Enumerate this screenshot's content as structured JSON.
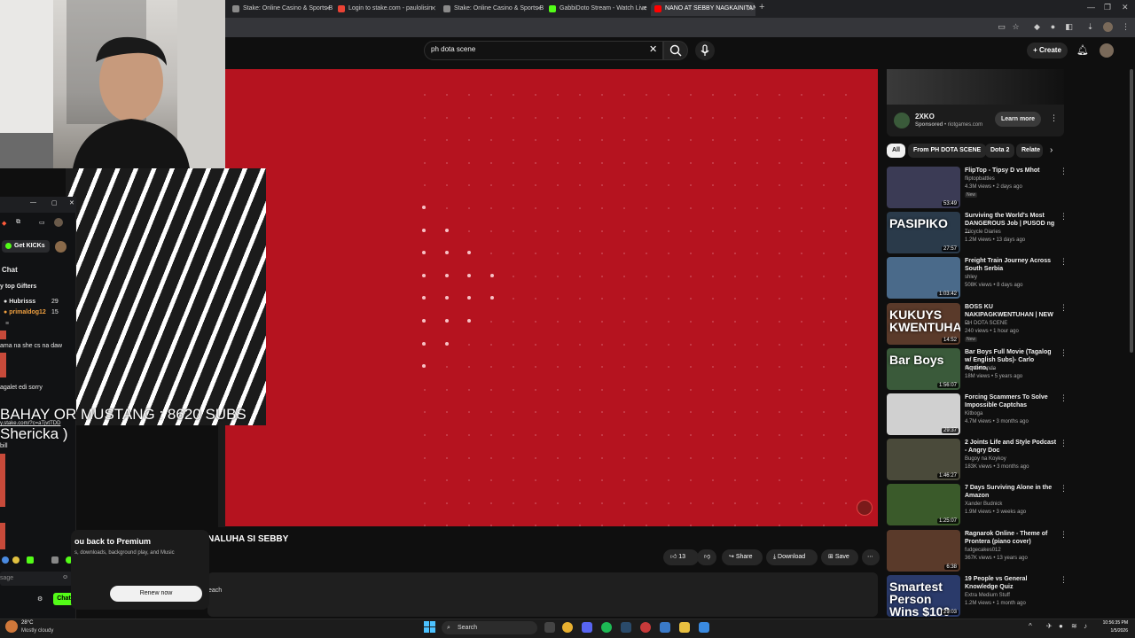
{
  "browser": {
    "tabs": [
      {
        "label": "Stake: Online Casino & Sports B",
        "favicon_color": "#8a8a8a"
      },
      {
        "label": "Login to stake.com - paulolisin",
        "favicon_color": "#ea4335"
      },
      {
        "label": "Stake: Online Casino & Sports B",
        "favicon_color": "#8a8a8a"
      },
      {
        "label": "GabbiDoto Stream - Watch Live",
        "favicon_color": "#53fc18"
      },
      {
        "label": "NANO AT SEBBY NAGKAINITAN",
        "favicon_color": "#ff0000"
      }
    ],
    "new_tab": "+",
    "window_controls": [
      "—",
      "❐",
      "✕"
    ]
  },
  "youtube": {
    "search_value": "ph dota scene",
    "create_label": "Create",
    "video_title": "NALUHA SI SEBBY",
    "actions": {
      "likes": "13",
      "share": "Share",
      "download": "Download",
      "save": "Save"
    },
    "description_snippet": "each",
    "ad": {
      "name": "2XKO",
      "sponsored": "Sponsored",
      "domain": "riotgames.com",
      "cta": "Learn more"
    },
    "chips": [
      "All",
      "From PH DOTA SCENE",
      "Dota 2",
      "Relate"
    ],
    "recommendations": [
      {
        "title": "FlipTop - Tipsy D vs Mhot",
        "channel": "fliptopbattles",
        "meta": "4.3M views • 2 days ago",
        "badge": "New",
        "duration": "53:49",
        "thumb": "#3b3b55"
      },
      {
        "title": "Surviving the World's Most DANGEROUS Job | PUSOD ng ...",
        "channel": "Tricycle Diaries",
        "meta": "1.2M views • 13 days ago",
        "badge": "",
        "duration": "27:57",
        "thumb_text": "PASIPIKO",
        "thumb": "#2a3a4a"
      },
      {
        "title": "Freight Train Journey Across South Serbia",
        "channel": "shley",
        "meta": "508K views • 8 days ago",
        "badge": "",
        "duration": "1:03:42",
        "thumb": "#4a6a8a"
      },
      {
        "title": "BOSS KU NAKIPAGKWENTUHAN | NEW ...",
        "channel": "PH DOTA SCENE",
        "meta": "240 views • 1 hour ago",
        "badge": "New",
        "duration": "14:52",
        "thumb_text": "KUKUYS KWENTUHAN",
        "thumb": "#5a3a2a"
      },
      {
        "title": "Bar Boys Full Movie (Tagalog w/ English Subs)- Carlo Aquino, ...",
        "channel": "Kip Oebanda",
        "meta": "18M views • 5 years ago",
        "badge": "",
        "duration": "1:56:07",
        "thumb_text": "Bar Boys",
        "thumb": "#3a5a3a"
      },
      {
        "title": "Forcing Scammers To Solve Impossible Captchas",
        "channel": "Kitboga",
        "meta": "4.7M views • 3 months ago",
        "badge": "",
        "duration": "29:37",
        "thumb": "#d0d0d0"
      },
      {
        "title": "2 Joints Life and Style Podcast - Angry Doc",
        "channel": "Bugoy na Koykoy",
        "meta": "183K views • 3 months ago",
        "badge": "",
        "duration": "1:46:27",
        "thumb": "#4a4a3a"
      },
      {
        "title": "7 Days Surviving Alone in the Amazon",
        "channel": "Xander Budnick",
        "meta": "1.9M views • 3 weeks ago",
        "badge": "",
        "duration": "1:25:07",
        "thumb": "#3a5a2a"
      },
      {
        "title": "Ragnarok Online - Theme of Prontera (piano cover)",
        "channel": "fudgecakes012",
        "meta": "367K views • 13 years ago",
        "badge": "",
        "duration": "6:38",
        "thumb": "#5a3a2a"
      },
      {
        "title": "19 People vs General Knowledge Quiz",
        "channel": "Extra Medium Stuff",
        "meta": "1.2M views • 1 month ago",
        "badge": "",
        "duration": "29:03",
        "thumb_text": "Smartest Person Wins $100",
        "thumb": "#2a3a6a"
      }
    ],
    "premium": {
      "title": "ou back to Premium",
      "desc": "s, downloads, background play, and Music",
      "renew": "Renew now"
    }
  },
  "kick": {
    "get_kicks": "Get KICKs",
    "chat_heading": "Chat",
    "gifters_heading": "y top Gifters",
    "gifters": [
      {
        "name": "Hubrisss",
        "count": "29"
      },
      {
        "name": "primaldog12",
        "count": "15"
      }
    ],
    "messages": [
      "ama na she cs na daw",
      "agalet edi sorry",
      "y.stake.com/?c=aTjvtTDD",
      "bill"
    ],
    "input_placeholder": "sage",
    "chat_button": "Chat"
  },
  "overlay": {
    "line1": "BAHAY OR MUSTANG : 8620 SUBS",
    "line2": "Shericka )"
  },
  "taskbar": {
    "temp": "28°C",
    "weather": "Mostly cloudy",
    "search": "Search",
    "time": "10:56:35 PM",
    "date": "1/5/2026"
  }
}
